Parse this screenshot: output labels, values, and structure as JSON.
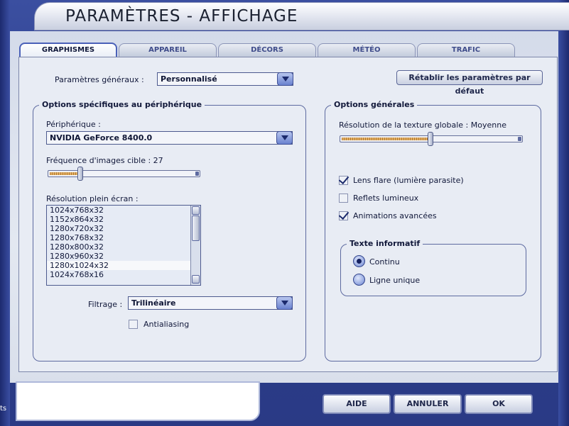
{
  "window": {
    "title": "PARAMÈTRES - AFFICHAGE",
    "side_text": "ts"
  },
  "tabs": [
    {
      "label": "GRAPHISMES",
      "active": true
    },
    {
      "label": "APPAREIL"
    },
    {
      "label": "DÉCORS"
    },
    {
      "label": "MÉTÉO"
    },
    {
      "label": "TRAFIC"
    }
  ],
  "general": {
    "label": "Paramètres généraux :",
    "value": "Personnalisé",
    "reset_button": "Rétablir les paramètres par défaut"
  },
  "device_group": {
    "title": "Options spécifiques au périphérique",
    "device_label": "Périphérique :",
    "device_value": "NVIDIA GeForce 8400.0",
    "framerate_label": "Fréquence d'images cible : 27",
    "framerate_slider": 0.2,
    "resolution_label": "Résolution plein écran :",
    "resolutions": [
      "1024x768x32",
      "1152x864x32",
      "1280x720x32",
      "1280x768x32",
      "1280x800x32",
      "1280x960x32",
      "1280x1024x32",
      "1024x768x16"
    ],
    "selected_resolution": "1280x1024x32",
    "filter_label": "Filtrage :",
    "filter_value": "Trilinéaire",
    "antialiasing_label": "Antialiasing",
    "antialiasing_checked": false
  },
  "general_group": {
    "title": "Options générales",
    "texture_label": "Résolution de la texture globale : Moyenne",
    "texture_slider": 0.5,
    "lens_flare_label": "Lens flare (lumière parasite)",
    "lens_flare_checked": true,
    "reflections_label": "Reflets lumineux",
    "reflections_checked": false,
    "animations_label": "Animations avancées",
    "animations_checked": true,
    "info_text": {
      "title": "Texte informatif",
      "options": [
        "Continu",
        "Ligne unique"
      ],
      "selected": "Continu"
    }
  },
  "footer": {
    "help": "AIDE",
    "cancel": "ANNULER",
    "ok": "OK"
  },
  "colors": {
    "frame": "#2d3f8f",
    "panel": "#e8ecf4",
    "accent": "#4a61b8"
  }
}
